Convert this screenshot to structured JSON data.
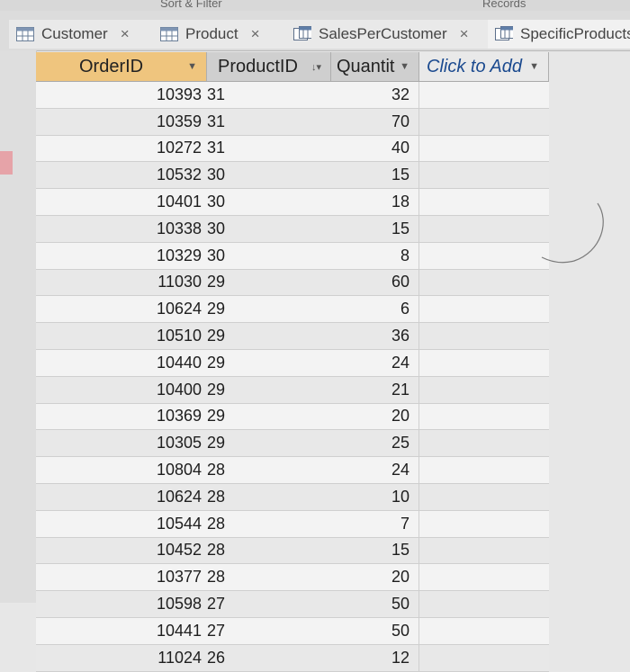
{
  "ribbon": {
    "group_left": "Sort & Filter",
    "group_right": "Records"
  },
  "tabs": [
    {
      "label": "Customer",
      "icon": "table-icon",
      "close": "×"
    },
    {
      "label": "Product",
      "icon": "table-icon",
      "close": "×"
    },
    {
      "label": "SalesPerCustomer",
      "icon": "query-icon",
      "close": "×"
    },
    {
      "label": "SpecificProducts",
      "icon": "query-icon",
      "close": ""
    }
  ],
  "columns": {
    "order": "OrderID",
    "product": "ProductID",
    "quantity": "Quantit",
    "add": "Click to Add"
  },
  "rows": [
    {
      "order": "10393",
      "product": "31",
      "qty": "32"
    },
    {
      "order": "10359",
      "product": "31",
      "qty": "70"
    },
    {
      "order": "10272",
      "product": "31",
      "qty": "40"
    },
    {
      "order": "10532",
      "product": "30",
      "qty": "15"
    },
    {
      "order": "10401",
      "product": "30",
      "qty": "18"
    },
    {
      "order": "10338",
      "product": "30",
      "qty": "15"
    },
    {
      "order": "10329",
      "product": "30",
      "qty": "8"
    },
    {
      "order": "11030",
      "product": "29",
      "qty": "60"
    },
    {
      "order": "10624",
      "product": "29",
      "qty": "6"
    },
    {
      "order": "10510",
      "product": "29",
      "qty": "36"
    },
    {
      "order": "10440",
      "product": "29",
      "qty": "24"
    },
    {
      "order": "10400",
      "product": "29",
      "qty": "21"
    },
    {
      "order": "10369",
      "product": "29",
      "qty": "20"
    },
    {
      "order": "10305",
      "product": "29",
      "qty": "25"
    },
    {
      "order": "10804",
      "product": "28",
      "qty": "24"
    },
    {
      "order": "10624",
      "product": "28",
      "qty": "10"
    },
    {
      "order": "10544",
      "product": "28",
      "qty": "7"
    },
    {
      "order": "10452",
      "product": "28",
      "qty": "15"
    },
    {
      "order": "10377",
      "product": "28",
      "qty": "20"
    },
    {
      "order": "10598",
      "product": "27",
      "qty": "50"
    },
    {
      "order": "10441",
      "product": "27",
      "qty": "50"
    },
    {
      "order": "11024",
      "product": "26",
      "qty": "12"
    }
  ],
  "colors": {
    "selected_header": "#efc57e",
    "click_to_add": "#1b4a8f",
    "row_selector": "#e6a3a8"
  }
}
